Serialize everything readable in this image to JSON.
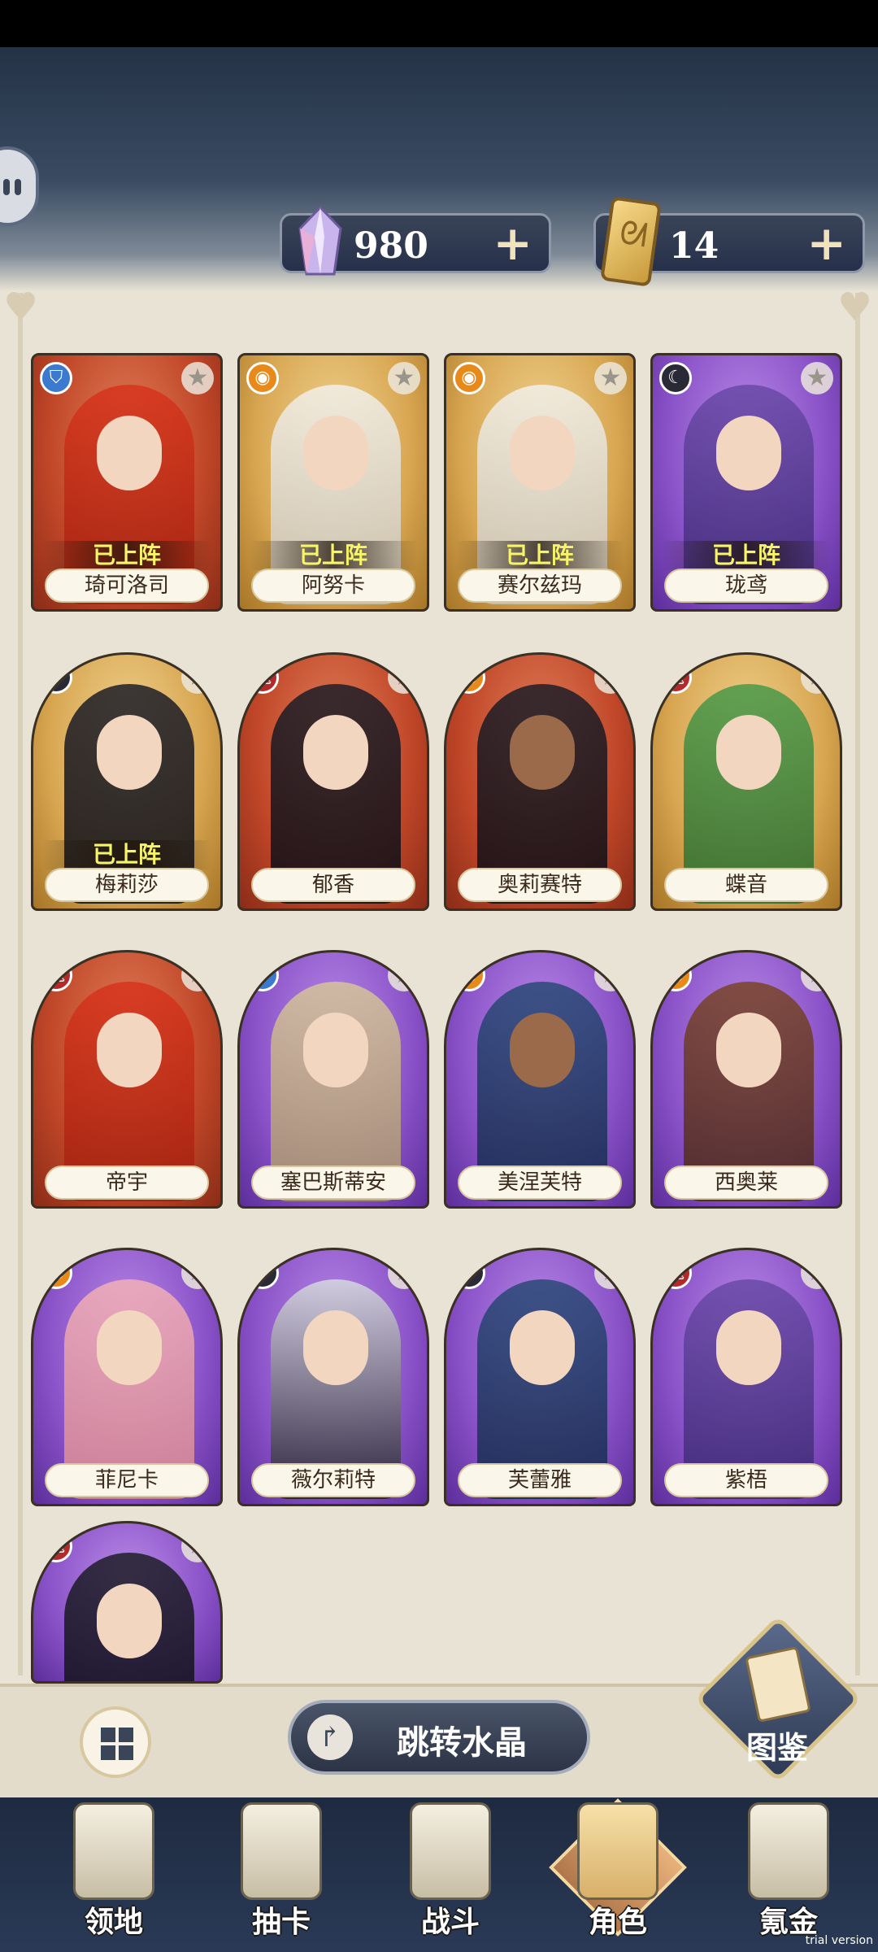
{
  "currency": {
    "crystals": "980",
    "tickets": "14",
    "add_label": "+"
  },
  "cards": [
    {
      "name": "琦可洛司",
      "deployed": "已上阵",
      "class_icon": "shield-icon",
      "bg": "red"
    },
    {
      "name": "阿努卡",
      "deployed": "已上阵",
      "class_icon": "eye-icon",
      "bg": "gold"
    },
    {
      "name": "赛尔兹玛",
      "deployed": "已上阵",
      "class_icon": "eye-icon",
      "bg": "gold"
    },
    {
      "name": "珑鸢",
      "deployed": "已上阵",
      "class_icon": "moon-icon",
      "bg": "purple"
    },
    {
      "name": "梅莉莎",
      "deployed": "已上阵",
      "class_icon": "moon-icon",
      "bg": "gold"
    },
    {
      "name": "郁香",
      "deployed": "",
      "class_icon": "dragon-icon",
      "bg": "red"
    },
    {
      "name": "奥莉赛特",
      "deployed": "",
      "class_icon": "eye-icon",
      "bg": "red"
    },
    {
      "name": "蝶音",
      "deployed": "",
      "class_icon": "dragon-icon",
      "bg": "gold"
    },
    {
      "name": "帝宇",
      "deployed": "",
      "class_icon": "dragon-icon",
      "bg": "red"
    },
    {
      "name": "塞巴斯蒂安",
      "deployed": "",
      "class_icon": "shield-icon",
      "bg": "purple"
    },
    {
      "name": "美涅芙特",
      "deployed": "",
      "class_icon": "eye-icon",
      "bg": "purple"
    },
    {
      "name": "西奥莱",
      "deployed": "",
      "class_icon": "eye-icon",
      "bg": "purple"
    },
    {
      "name": "菲尼卡",
      "deployed": "",
      "class_icon": "eye-icon",
      "bg": "purple"
    },
    {
      "name": "薇尔莉特",
      "deployed": "",
      "class_icon": "moon-icon",
      "bg": "purple"
    },
    {
      "name": "芙蕾雅",
      "deployed": "",
      "class_icon": "moon-icon",
      "bg": "purple"
    },
    {
      "name": "紫梧",
      "deployed": "",
      "class_icon": "dragon-icon",
      "bg": "purple"
    },
    {
      "name": "",
      "deployed": "",
      "class_icon": "dragon-icon",
      "bg": "purple"
    }
  ],
  "actions": {
    "jump_label": "跳转水晶",
    "codex_label": "图鉴"
  },
  "nav": [
    {
      "label": "领地",
      "icon": "castle-icon",
      "active": false
    },
    {
      "label": "抽卡",
      "icon": "cards-icon",
      "active": false
    },
    {
      "label": "战斗",
      "icon": "swords-icon",
      "active": false
    },
    {
      "label": "角色",
      "icon": "character-icon",
      "active": true
    },
    {
      "label": "氪金",
      "icon": "treasure-chest-icon",
      "active": false
    }
  ],
  "watermark": "trial version"
}
